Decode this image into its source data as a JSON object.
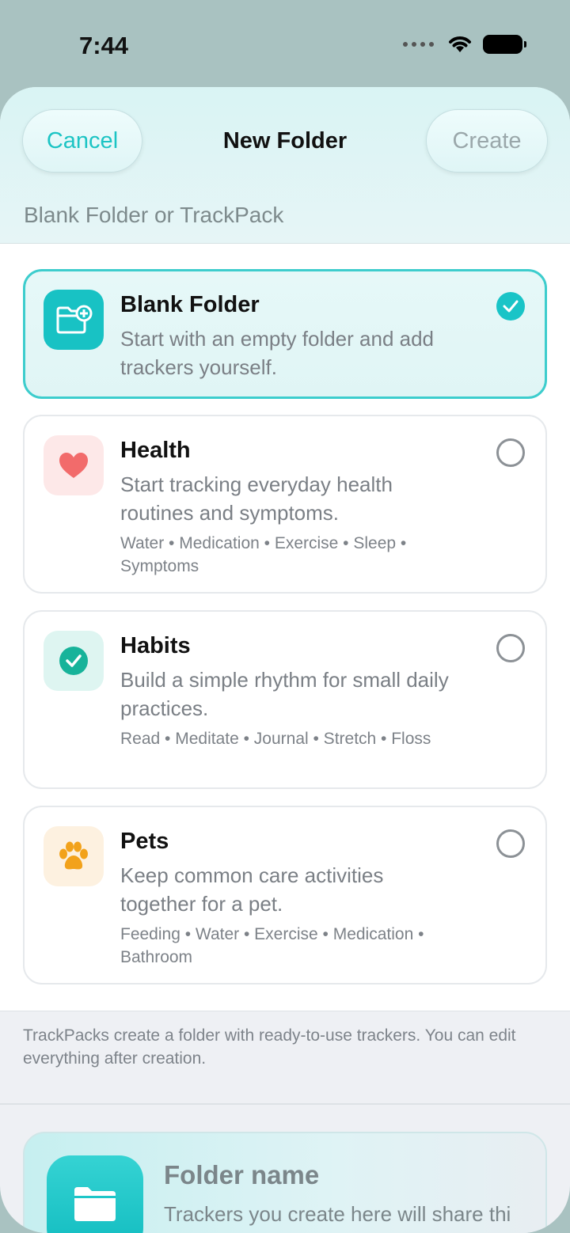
{
  "status_bar": {
    "time": "7:44"
  },
  "header": {
    "cancel_label": "Cancel",
    "title": "New Folder",
    "create_label": "Create",
    "section_label": "Blank Folder or TrackPack"
  },
  "options": [
    {
      "title": "Blank Folder",
      "description": "Start with an empty folder and add trackers yourself.",
      "tags": "",
      "selected": true,
      "icon": "folder-plus-icon"
    },
    {
      "title": "Health",
      "description": "Start tracking everyday health routines and symptoms.",
      "tags": "Water • Medication • Exercise • Sleep • Symptoms",
      "selected": false,
      "icon": "heart-icon"
    },
    {
      "title": "Habits",
      "description": "Build a simple rhythm for small daily practices.",
      "tags": "Read • Meditate • Journal • Stretch • Floss",
      "selected": false,
      "icon": "checkmark-circle-icon"
    },
    {
      "title": "Pets",
      "description": "Keep common care activities together for a pet.",
      "tags": "Feeding • Water • Exercise • Medication • Bathroom",
      "selected": false,
      "icon": "paw-icon"
    }
  ],
  "footer_note": "TrackPacks create a folder with ready-to-use trackers. You can edit everything after creation.",
  "folder_name_card": {
    "title": "Folder name",
    "subtitle": "Trackers you create here will share thi"
  },
  "colors": {
    "accent": "#1cc4c4",
    "heart": "#f26b6b",
    "paw": "#f2a21b"
  }
}
